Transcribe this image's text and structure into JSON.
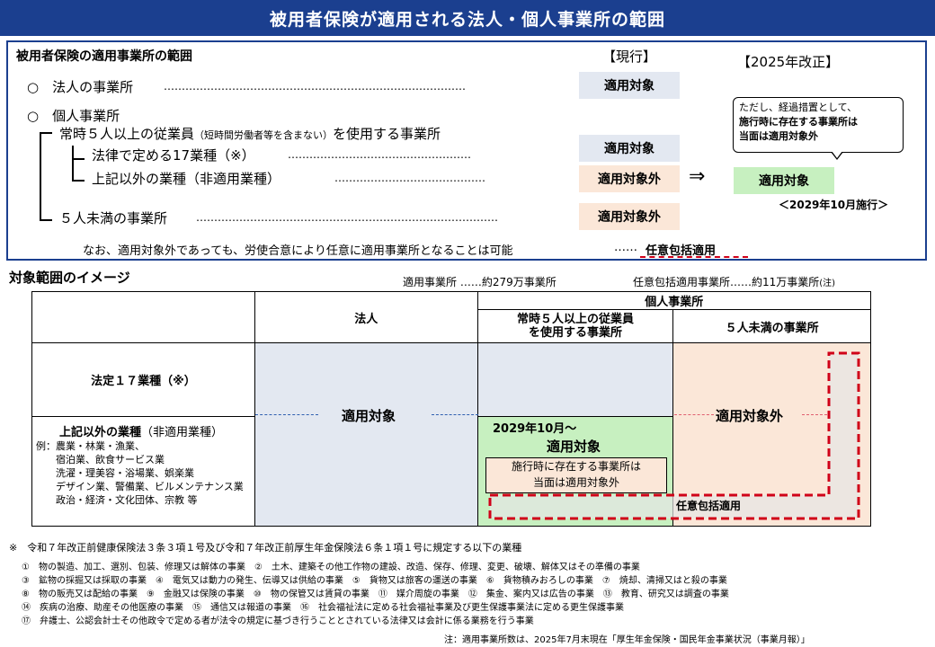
{
  "title": "被用者保険が適用される法人・個人事業所の範囲",
  "section1": {
    "heading": "被用者保険の適用事業所の範囲",
    "col_current": "【現行】",
    "col_reform": "【2025年改正】",
    "row_corp": "○　法人の事業所",
    "row_corp_dots": "…………………………………………………………………………",
    "row_indiv": "○　個人事業所",
    "row_5plus_a": "常時５人以上の従業員",
    "row_5plus_b": "（短時間労働者等を含まない）",
    "row_5plus_c": "を使用する事業所",
    "row_17": "法律で定める17業種（※）",
    "row_17_dots": "……………………………………………",
    "row_other": "上記以外の業種（非適用業種）",
    "row_other_dots": "……………………………………",
    "row_under5": "５人未満の事業所",
    "row_under5_dots": "…………………………………………………………………………",
    "note": "なお、適用対象外であっても、労使合意により任意に適用事業所となることは可能",
    "note_dots": "……",
    "voluntary": "任意包括適用",
    "badge_applied": "適用対象",
    "badge_excluded": "適用対象外",
    "arrow": "⇒",
    "reform_badge": "適用対象",
    "reform_date": "＜2029年10月施行＞",
    "callout_1": "ただし、経過措置として、",
    "callout_2": "施行時に存在する事業所は",
    "callout_3": "当面は適用対象外"
  },
  "section2": {
    "heading": "対象範囲のイメージ",
    "stat1": "適用事業所 ……約279万事業所",
    "stat2": "任意包括適用事業所……約11万事業所",
    "stat2_note": "(注)",
    "hdr_corp": "法人",
    "hdr_indiv": "個人事業所",
    "hdr_5plus": "常時５人以上の従業員\nを使用する事業所",
    "hdr_under5": "５人未満の事業所",
    "row1_label": "法定１７業種（※）",
    "row2_label_b": "上記以外の業種",
    "row2_label_n": "（非適用業種）",
    "row2_examples": "例：農業・林業・漁業、\n　　宿泊業、飲食サービス業\n　　洗濯・理美容・浴場業、娯楽業\n　　デザイン業、警備業、ビルメンテナンス業\n　　政治・経済・文化団体、宗教 等",
    "applied": "適用対象",
    "excluded": "適用対象外",
    "green_date": "2029年10月～",
    "green_applied": "適用対象",
    "green_box": "施行時に存在する事業所は\n当面は適用対象外",
    "voluntary": "任意包括適用"
  },
  "footnote": {
    "main": "※　令和７年改正前健康保険法３条３項１号及び令和７年改正前厚生年金保険法６条１項１号に規定する以下の業種",
    "l1": "①　物の製造、加工、選別、包装、修理又は解体の事業　②　土木、建築その他工作物の建設、改造、保存、修理、変更、破壊、解体又はその準備の事業",
    "l2": "③　鉱物の採掘又は採取の事業　④　電気又は動力の発生、伝導又は供給の事業　⑤　貨物又は旅客の運送の事業　⑥　貨物積みおろしの事業　⑦　焼却、清掃又はと殺の事業",
    "l3": "⑧　物の販売又は配給の事業　⑨　金融又は保険の事業　⑩　物の保管又は賃貸の事業　⑪　媒介周旋の事業　⑫　集金、案内又は広告の事業　⑬　教育、研究又は調査の事業",
    "l4": "⑭　疾病の治療、助産その他医療の事業　⑮　通信又は報道の事業　⑯　社会福祉法に定める社会福祉事業及び更生保護事業法に定める更生保護事業",
    "l5": "⑰　弁護士、公認会計士その他政令で定める者が法令の規定に基づき行うこととされている法律又は会計に係る業務を行う事業",
    "source": "注：適用事業所数は、2025年7月末現在「厚生年金保険・国民年金事業状況（事業月報）」"
  }
}
